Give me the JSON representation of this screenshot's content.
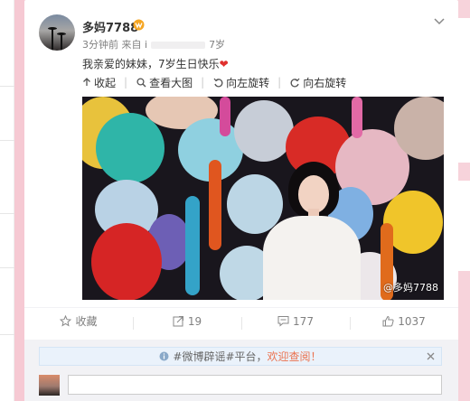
{
  "post": {
    "author": "多妈7788",
    "meta_time": "3分钟前",
    "meta_from": "来自 i",
    "meta_suffix": "7岁",
    "text_main": "我亲爱的妹妹，7岁生日快乐",
    "text_heart": "❤"
  },
  "toolbar": {
    "collapse": "收起",
    "view_large": "查看大图",
    "rotate_left": "向左旋转",
    "rotate_right": "向右旋转"
  },
  "photo": {
    "watermark": "@多妈7788"
  },
  "actions": {
    "favorite": "收藏",
    "forward_count": "19",
    "comment_count": "177",
    "like_count": "1037"
  },
  "comment": {
    "notice_prefix": "#微博辟谣#平台，",
    "notice_link": "欢迎查阅！",
    "input_placeholder": ""
  },
  "colors": {
    "accent_orange": "#eb7350",
    "heart_red": "#e0302e",
    "vip_orange": "#f5a623",
    "page_pink": "#f6c9d3"
  },
  "icons": {
    "vip": "vip-badge-icon",
    "chevron": "chevron-down-icon",
    "collapse": "collapse-arrow-icon",
    "zoom": "magnifier-icon",
    "rotate_left": "rotate-left-icon",
    "rotate_right": "rotate-right-icon",
    "favorite": "star-icon",
    "forward": "forward-icon",
    "comment": "comment-icon",
    "like": "thumb-up-icon",
    "info": "info-icon",
    "close": "close-icon"
  }
}
